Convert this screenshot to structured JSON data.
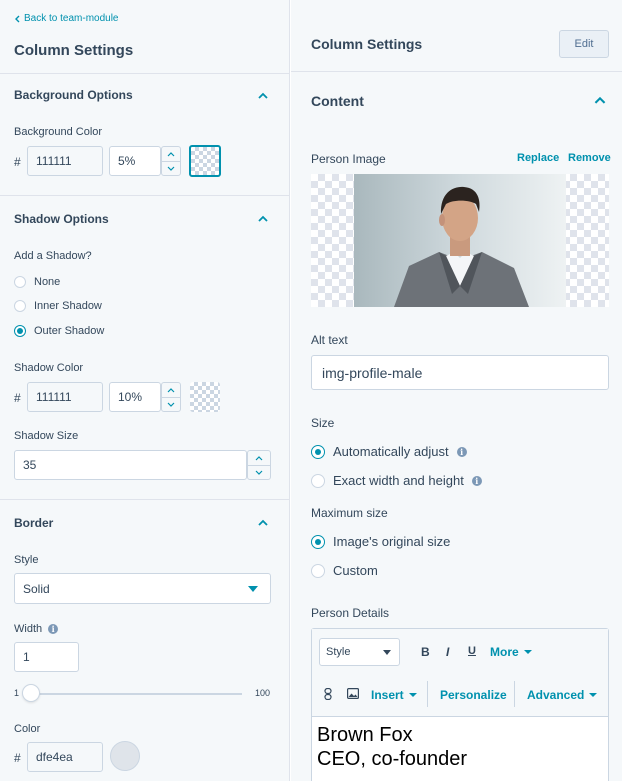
{
  "left": {
    "back_link": "Back to team-module",
    "title": "Column Settings",
    "background": {
      "section_title": "Background Options",
      "color_label": "Background Color",
      "hash": "#",
      "color_value": "111111",
      "opacity_value": "5%"
    },
    "shadow": {
      "section_title": "Shadow Options",
      "add_label": "Add a Shadow?",
      "options": [
        "None",
        "Inner Shadow",
        "Outer Shadow"
      ],
      "selected": "Outer Shadow",
      "color_label": "Shadow Color",
      "hash": "#",
      "color_value": "111111",
      "opacity_value": "10%",
      "size_label": "Shadow Size",
      "size_value": "35"
    },
    "border": {
      "section_title": "Border",
      "style_label": "Style",
      "style_value": "Solid",
      "width_label": "Width",
      "width_value": "1",
      "slider_min": "1",
      "slider_max": "100",
      "color_label": "Color",
      "hash": "#",
      "color_value": "dfe4ea"
    }
  },
  "right": {
    "title": "Column Settings",
    "edit_label": "Edit",
    "content_title": "Content",
    "person_image_label": "Person Image",
    "replace_label": "Replace",
    "remove_label": "Remove",
    "alt_label": "Alt text",
    "alt_value": "img-profile-male",
    "size_label": "Size",
    "size_options": [
      "Automatically adjust",
      "Exact width and height"
    ],
    "size_selected": "Automatically adjust",
    "max_size_label": "Maximum size",
    "max_size_options": [
      "Image's original size",
      "Custom"
    ],
    "max_size_selected": "Image's original size",
    "details_label": "Person Details",
    "toolbar": {
      "style_label": "Style",
      "bold": "B",
      "italic": "I",
      "underline": "U",
      "more": "More",
      "insert": "Insert",
      "personalize": "Personalize",
      "advanced": "Advanced"
    },
    "editor_lines": [
      "Brown Fox",
      "CEO, co-founder"
    ]
  },
  "colors": {
    "accent": "#0091ae",
    "text": "#33475b",
    "panel_bg": "#f5f8fa",
    "border": "#cbd6e2"
  }
}
